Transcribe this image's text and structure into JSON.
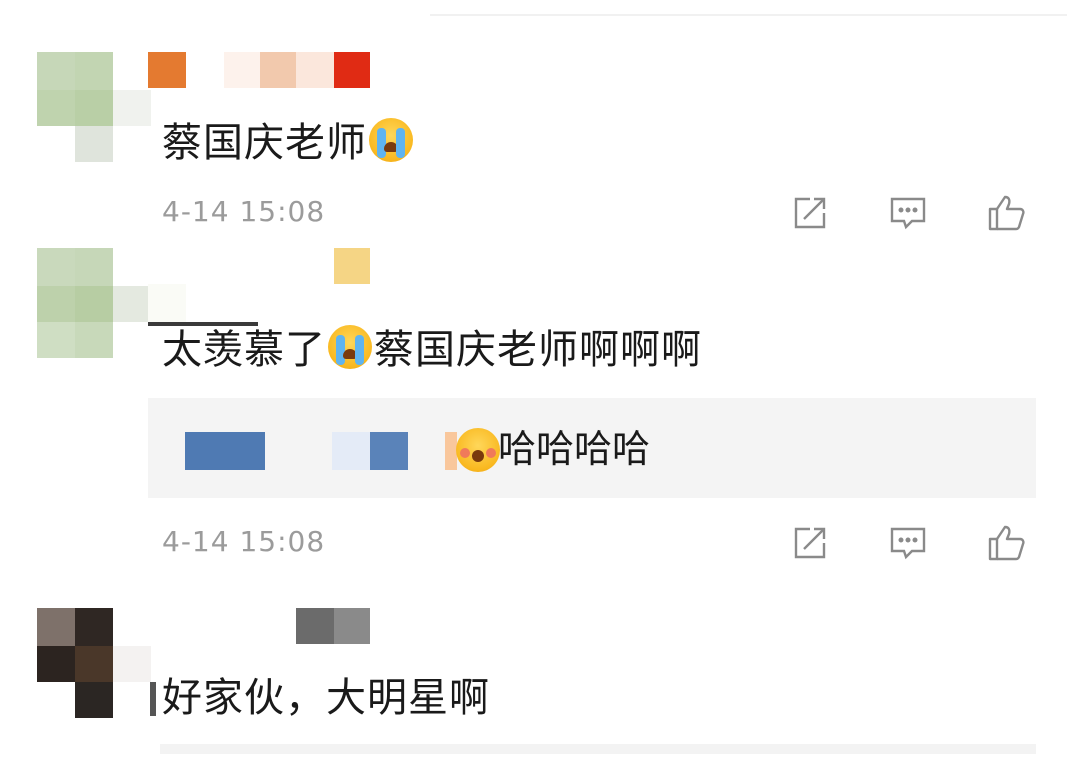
{
  "comments": [
    {
      "text": "蔡国庆老师",
      "emoji": "crying-face",
      "time": "4-14 15:08"
    },
    {
      "text_before": "太羡慕了",
      "emoji": "crying-face",
      "text_after": "蔡国庆老师啊啊啊",
      "reply": {
        "text": "哈哈哈哈",
        "emoji": "blushing-face"
      },
      "time": "4-14 15:08"
    },
    {
      "text": "好家伙，大明星啊"
    }
  ],
  "icons": {
    "share": "share-icon",
    "reply": "comment-icon",
    "like": "thumbs-up-icon"
  },
  "colors": {
    "time": "#9b9b9b",
    "reply_bg": "#f4f4f4",
    "icon": "#8a8a8a"
  }
}
